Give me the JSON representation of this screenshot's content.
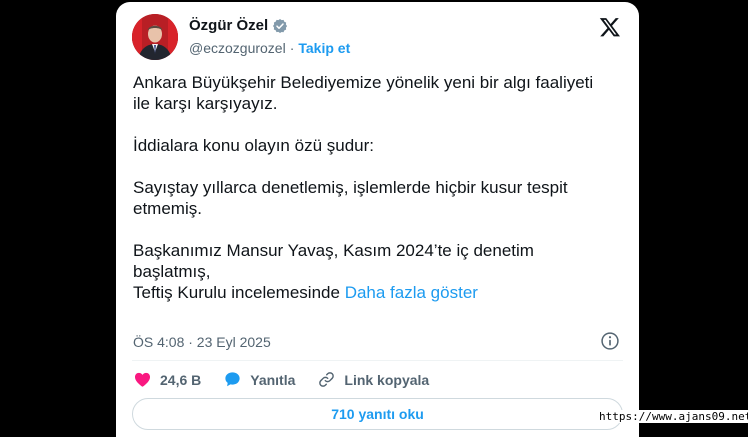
{
  "author": {
    "name": "Özgür Özel",
    "handle": "@eczozgurozel",
    "separator": "·",
    "follow_label": "Takip et"
  },
  "tweet": {
    "paragraphs": [
      "Ankara Büyükşehir Belediyemize yönelik yeni bir algı faaliyeti ile karşı karşıyayız.",
      "İddialara konu olayın özü şudur:",
      "Sayıştay yıllarca denetlemiş, işlemlerde hiçbir kusur tespit etmemiş."
    ],
    "last_line_1": "Başkanımız Mansur Yavaş, Kasım 2024’te iç denetim başlatmış,",
    "last_line_2": "Teftiş Kurulu incelemesinde",
    "show_more": "Daha fazla göster",
    "timestamp": "ÖS 4:08 · 23 Eyl 2025"
  },
  "actions": {
    "likes": "24,6 B",
    "reply_label": "Yanıtla",
    "copy_link_label": "Link kopyala"
  },
  "replies_button": "710 yanıtı oku",
  "watermark": "https://www.ajans09.net",
  "colors": {
    "accent": "#1d9bf0",
    "like": "#f91880",
    "text": "#0f1419",
    "secondary": "#536471"
  },
  "icons": [
    "verified-badge-icon",
    "x-logo-icon",
    "info-icon",
    "heart-icon",
    "reply-bubble-icon",
    "link-icon"
  ]
}
